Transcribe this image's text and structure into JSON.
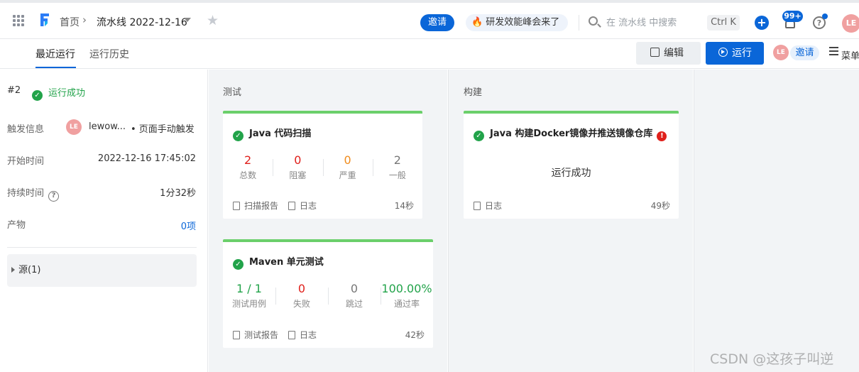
{
  "header": {
    "home": "首页",
    "pipeline_title": "流水线 2022-12-16",
    "invite": "邀请",
    "promo": "研发效能峰会来了",
    "search_placeholder": "在 流水线 中搜索",
    "shortcut": "Ctrl K",
    "notifications": "99+",
    "avatar": "LE"
  },
  "subbar": {
    "tabs": [
      "最近运行",
      "运行历史"
    ],
    "edit": "编辑",
    "run": "运行",
    "avatar": "LE",
    "invite": "邀请",
    "menu": "菜单"
  },
  "run": {
    "number": "#2",
    "status": "运行成功",
    "rows": {
      "trigger_label": "触发信息",
      "trigger_avatar": "LE",
      "trigger_user": "lewow...",
      "trigger_type": "• 页面手动触发",
      "start_label": "开始时间",
      "start_value": "2022-12-16 17:45:02",
      "duration_label": "持续时间",
      "duration_value": "1分32秒",
      "artifact_label": "产物",
      "artifact_value": "0项"
    },
    "source": "源(1)"
  },
  "stages": [
    {
      "title": "测试",
      "jobs": [
        {
          "name": "Java 代码扫描",
          "metrics": [
            {
              "value": "2",
              "label": "总数"
            },
            {
              "value": "0",
              "label": "阻塞"
            },
            {
              "value": "0",
              "label": "严重"
            },
            {
              "value": "2",
              "label": "一般"
            }
          ],
          "links": [
            "扫描报告",
            "日志"
          ],
          "duration": "14秒"
        },
        {
          "name": "Maven 单元测试",
          "metrics": [
            {
              "value": "1 / 1",
              "label": "测试用例"
            },
            {
              "value": "0",
              "label": "失败"
            },
            {
              "value": "0",
              "label": "跳过"
            },
            {
              "value": "100.00%",
              "label": "通过率"
            }
          ],
          "links": [
            "测试报告",
            "日志"
          ],
          "duration": "42秒"
        }
      ]
    },
    {
      "title": "构建",
      "jobs": [
        {
          "name": "Java 构建Docker镜像并推送镜像仓库",
          "message": "运行成功",
          "links": [
            "日志"
          ],
          "duration": "49秒"
        }
      ]
    }
  ],
  "watermark": "CSDN @这孩子叫逆",
  "colors": {
    "accent": "#0a66d8",
    "success": "#22a34a",
    "danger": "#e0201b",
    "warning": "#f08c1e"
  }
}
